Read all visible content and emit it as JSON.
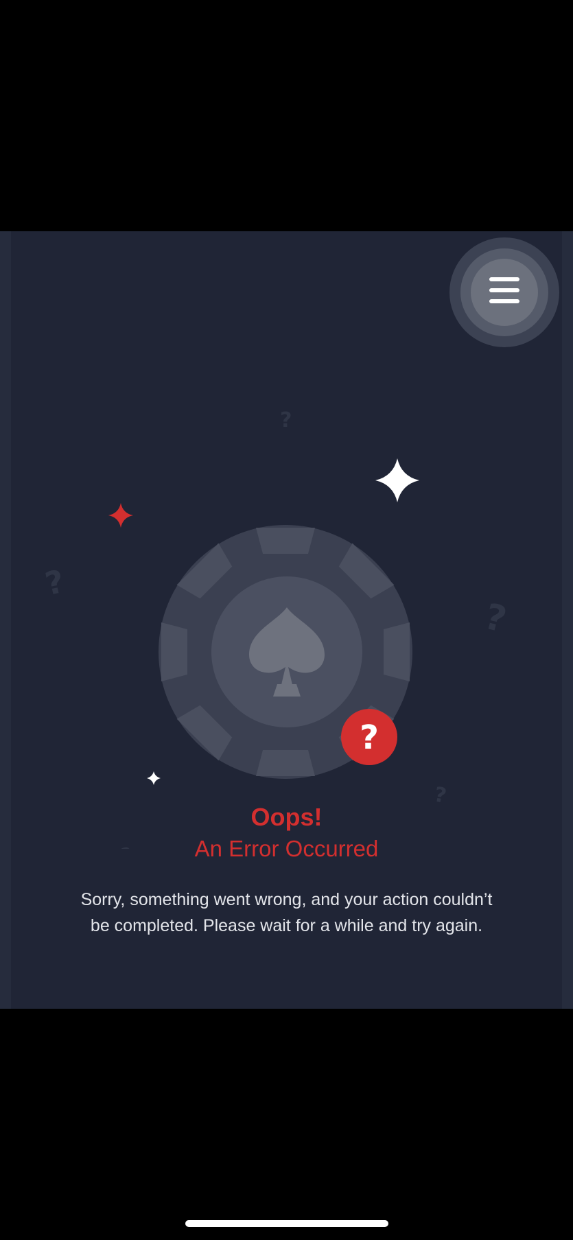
{
  "colors": {
    "panel_background": "#202536",
    "accent_red": "#d32f2f",
    "chip_outer": "#3b4051",
    "chip_inner": "#4a4f5f",
    "text_light": "#e3e5ea"
  },
  "header": {
    "menu_icon": "hamburger-menu-icon"
  },
  "illustration": {
    "icon": "poker-chip-spade-icon",
    "badge_icon": "question-mark-icon",
    "badge_glyph": "?",
    "decorations": [
      "sparkle-icon",
      "question-mark-icon"
    ]
  },
  "error": {
    "title": "Oops!",
    "subtitle": "An Error Occurred",
    "message_line1": "Sorry, something went wrong, and your action couldn’t",
    "message_line2": "be completed. Please wait for a while and try again."
  }
}
